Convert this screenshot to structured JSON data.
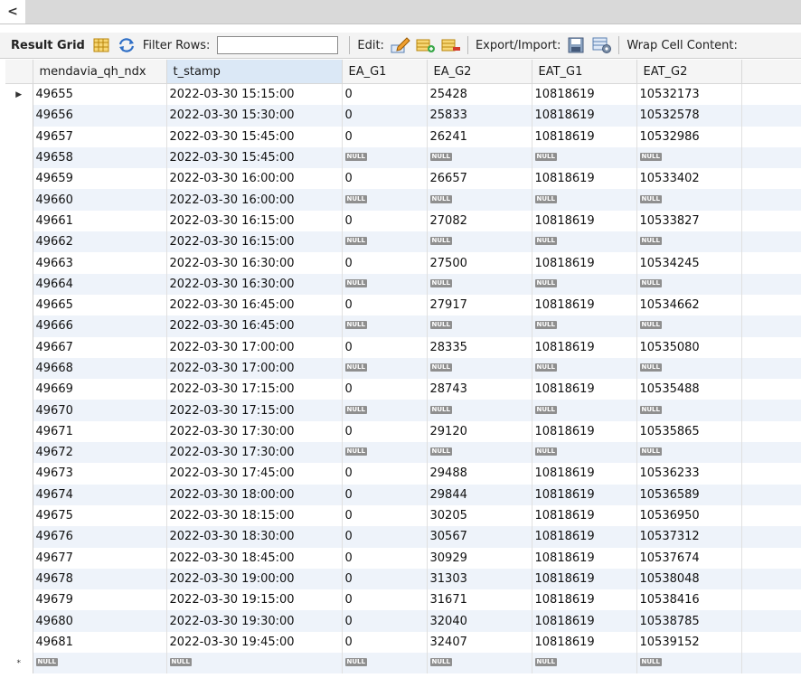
{
  "topbar": {
    "back_glyph": "<"
  },
  "toolbar": {
    "result_grid": "Result Grid",
    "filter_label": "Filter Rows:",
    "filter_value": "",
    "edit_label": "Edit:",
    "export_label": "Export/Import:",
    "wrap_label": "Wrap Cell Content:"
  },
  "null_label": "NULL",
  "grid": {
    "columns": [
      "mendavia_qh_ndx",
      "t_stamp",
      "EA_G1",
      "EA_G2",
      "EAT_G1",
      "EAT_G2"
    ],
    "rows": [
      [
        "49655",
        "2022-03-30 15:15:00",
        "0",
        "25428",
        "10818619",
        "10532173"
      ],
      [
        "49656",
        "2022-03-30 15:30:00",
        "0",
        "25833",
        "10818619",
        "10532578"
      ],
      [
        "49657",
        "2022-03-30 15:45:00",
        "0",
        "26241",
        "10818619",
        "10532986"
      ],
      [
        "49658",
        "2022-03-30 15:45:00",
        null,
        null,
        null,
        null
      ],
      [
        "49659",
        "2022-03-30 16:00:00",
        "0",
        "26657",
        "10818619",
        "10533402"
      ],
      [
        "49660",
        "2022-03-30 16:00:00",
        null,
        null,
        null,
        null
      ],
      [
        "49661",
        "2022-03-30 16:15:00",
        "0",
        "27082",
        "10818619",
        "10533827"
      ],
      [
        "49662",
        "2022-03-30 16:15:00",
        null,
        null,
        null,
        null
      ],
      [
        "49663",
        "2022-03-30 16:30:00",
        "0",
        "27500",
        "10818619",
        "10534245"
      ],
      [
        "49664",
        "2022-03-30 16:30:00",
        null,
        null,
        null,
        null
      ],
      [
        "49665",
        "2022-03-30 16:45:00",
        "0",
        "27917",
        "10818619",
        "10534662"
      ],
      [
        "49666",
        "2022-03-30 16:45:00",
        null,
        null,
        null,
        null
      ],
      [
        "49667",
        "2022-03-30 17:00:00",
        "0",
        "28335",
        "10818619",
        "10535080"
      ],
      [
        "49668",
        "2022-03-30 17:00:00",
        null,
        null,
        null,
        null
      ],
      [
        "49669",
        "2022-03-30 17:15:00",
        "0",
        "28743",
        "10818619",
        "10535488"
      ],
      [
        "49670",
        "2022-03-30 17:15:00",
        null,
        null,
        null,
        null
      ],
      [
        "49671",
        "2022-03-30 17:30:00",
        "0",
        "29120",
        "10818619",
        "10535865"
      ],
      [
        "49672",
        "2022-03-30 17:30:00",
        null,
        null,
        null,
        null
      ],
      [
        "49673",
        "2022-03-30 17:45:00",
        "0",
        "29488",
        "10818619",
        "10536233"
      ],
      [
        "49674",
        "2022-03-30 18:00:00",
        "0",
        "29844",
        "10818619",
        "10536589"
      ],
      [
        "49675",
        "2022-03-30 18:15:00",
        "0",
        "30205",
        "10818619",
        "10536950"
      ],
      [
        "49676",
        "2022-03-30 18:30:00",
        "0",
        "30567",
        "10818619",
        "10537312"
      ],
      [
        "49677",
        "2022-03-30 18:45:00",
        "0",
        "30929",
        "10818619",
        "10537674"
      ],
      [
        "49678",
        "2022-03-30 19:00:00",
        "0",
        "31303",
        "10818619",
        "10538048"
      ],
      [
        "49679",
        "2022-03-30 19:15:00",
        "0",
        "31671",
        "10818619",
        "10538416"
      ],
      [
        "49680",
        "2022-03-30 19:30:00",
        "0",
        "32040",
        "10818619",
        "10538785"
      ],
      [
        "49681",
        "2022-03-30 19:45:00",
        "0",
        "32407",
        "10818619",
        "10539152"
      ],
      [
        null,
        null,
        null,
        null,
        null,
        null
      ]
    ],
    "current_marker": "▶",
    "new_row_marker": "*"
  }
}
